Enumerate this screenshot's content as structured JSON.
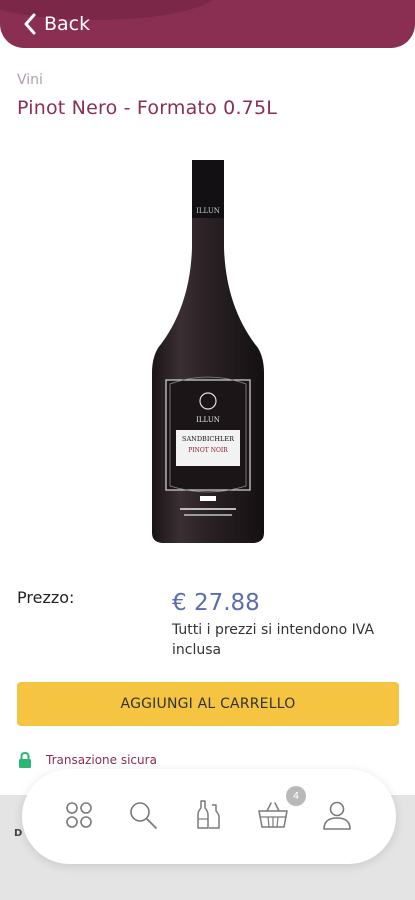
{
  "header": {
    "back_label": "Back"
  },
  "product": {
    "category": "Vini",
    "title": "Pinot Nero - Formato 0.75L",
    "bottle_brand": "ILLUN",
    "bottle_name": "SANDBICHLER",
    "bottle_variety": "PINOT NOIR"
  },
  "price": {
    "label": "Prezzo:",
    "value": "€ 27.88",
    "note": "Tutti i prezzi si intendono IVA inclusa"
  },
  "actions": {
    "add_to_cart": "AGGIUNGI AL CARRELLO"
  },
  "secure": {
    "text": "Transazione sicura"
  },
  "band": {
    "letter": "D"
  },
  "nav": {
    "items": [
      {
        "icon": "grid-icon"
      },
      {
        "icon": "search-icon"
      },
      {
        "icon": "bottles-icon"
      },
      {
        "icon": "basket-icon",
        "badge": "4"
      },
      {
        "icon": "user-icon"
      }
    ]
  },
  "colors": {
    "brand": "#8a2f52",
    "price": "#5b6db0",
    "button": "#f5c542",
    "secure_icon": "#2bb673"
  }
}
